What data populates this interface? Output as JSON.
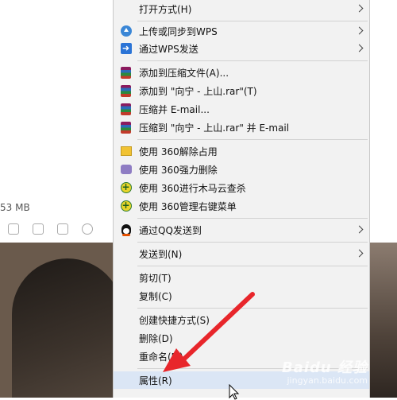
{
  "background": {
    "file_size": "53 MB"
  },
  "menu": {
    "items": [
      {
        "label": "打开方式(H)",
        "icon": "",
        "submenu": true
      },
      {
        "label": "上传或同步到WPS",
        "icon": "cloud-upload-icon",
        "submenu": true
      },
      {
        "label": "通过WPS发送",
        "icon": "wps-send-icon",
        "submenu": true
      },
      {
        "label": "添加到压缩文件(A)...",
        "icon": "winrar-icon",
        "submenu": false
      },
      {
        "label": "添加到 \"向宁 - 上山.rar\"(T)",
        "icon": "winrar-icon",
        "submenu": false
      },
      {
        "label": "压缩并 E-mail...",
        "icon": "winrar-icon",
        "submenu": false
      },
      {
        "label": "压缩到 \"向宁 - 上山.rar\" 并 E-mail",
        "icon": "winrar-icon",
        "submenu": false
      },
      {
        "label": "使用 360解除占用",
        "icon": "unlock-360-icon",
        "submenu": false
      },
      {
        "label": "使用 360强力删除",
        "icon": "shred-360-icon",
        "submenu": false
      },
      {
        "label": "使用 360进行木马云查杀",
        "icon": "scan-360-icon",
        "submenu": false
      },
      {
        "label": "使用 360管理右键菜单",
        "icon": "menu-360-icon",
        "submenu": false
      },
      {
        "label": "通过QQ发送到",
        "icon": "qq-icon",
        "submenu": true
      },
      {
        "label": "发送到(N)",
        "icon": "",
        "submenu": true
      },
      {
        "label": "剪切(T)",
        "icon": "",
        "submenu": false
      },
      {
        "label": "复制(C)",
        "icon": "",
        "submenu": false
      },
      {
        "label": "创建快捷方式(S)",
        "icon": "",
        "submenu": false
      },
      {
        "label": "删除(D)",
        "icon": "",
        "submenu": false
      },
      {
        "label": "重命名(M)",
        "icon": "",
        "submenu": false
      },
      {
        "label": "属性(R)",
        "icon": "",
        "submenu": false
      }
    ]
  },
  "colors": {
    "menu_bg": "#f2f2f2",
    "highlight": "#dbe6f5",
    "arrow": "#e8262b"
  },
  "watermark": {
    "brand": "Baidu 经验",
    "domain": "jingyan.baidu.com"
  }
}
